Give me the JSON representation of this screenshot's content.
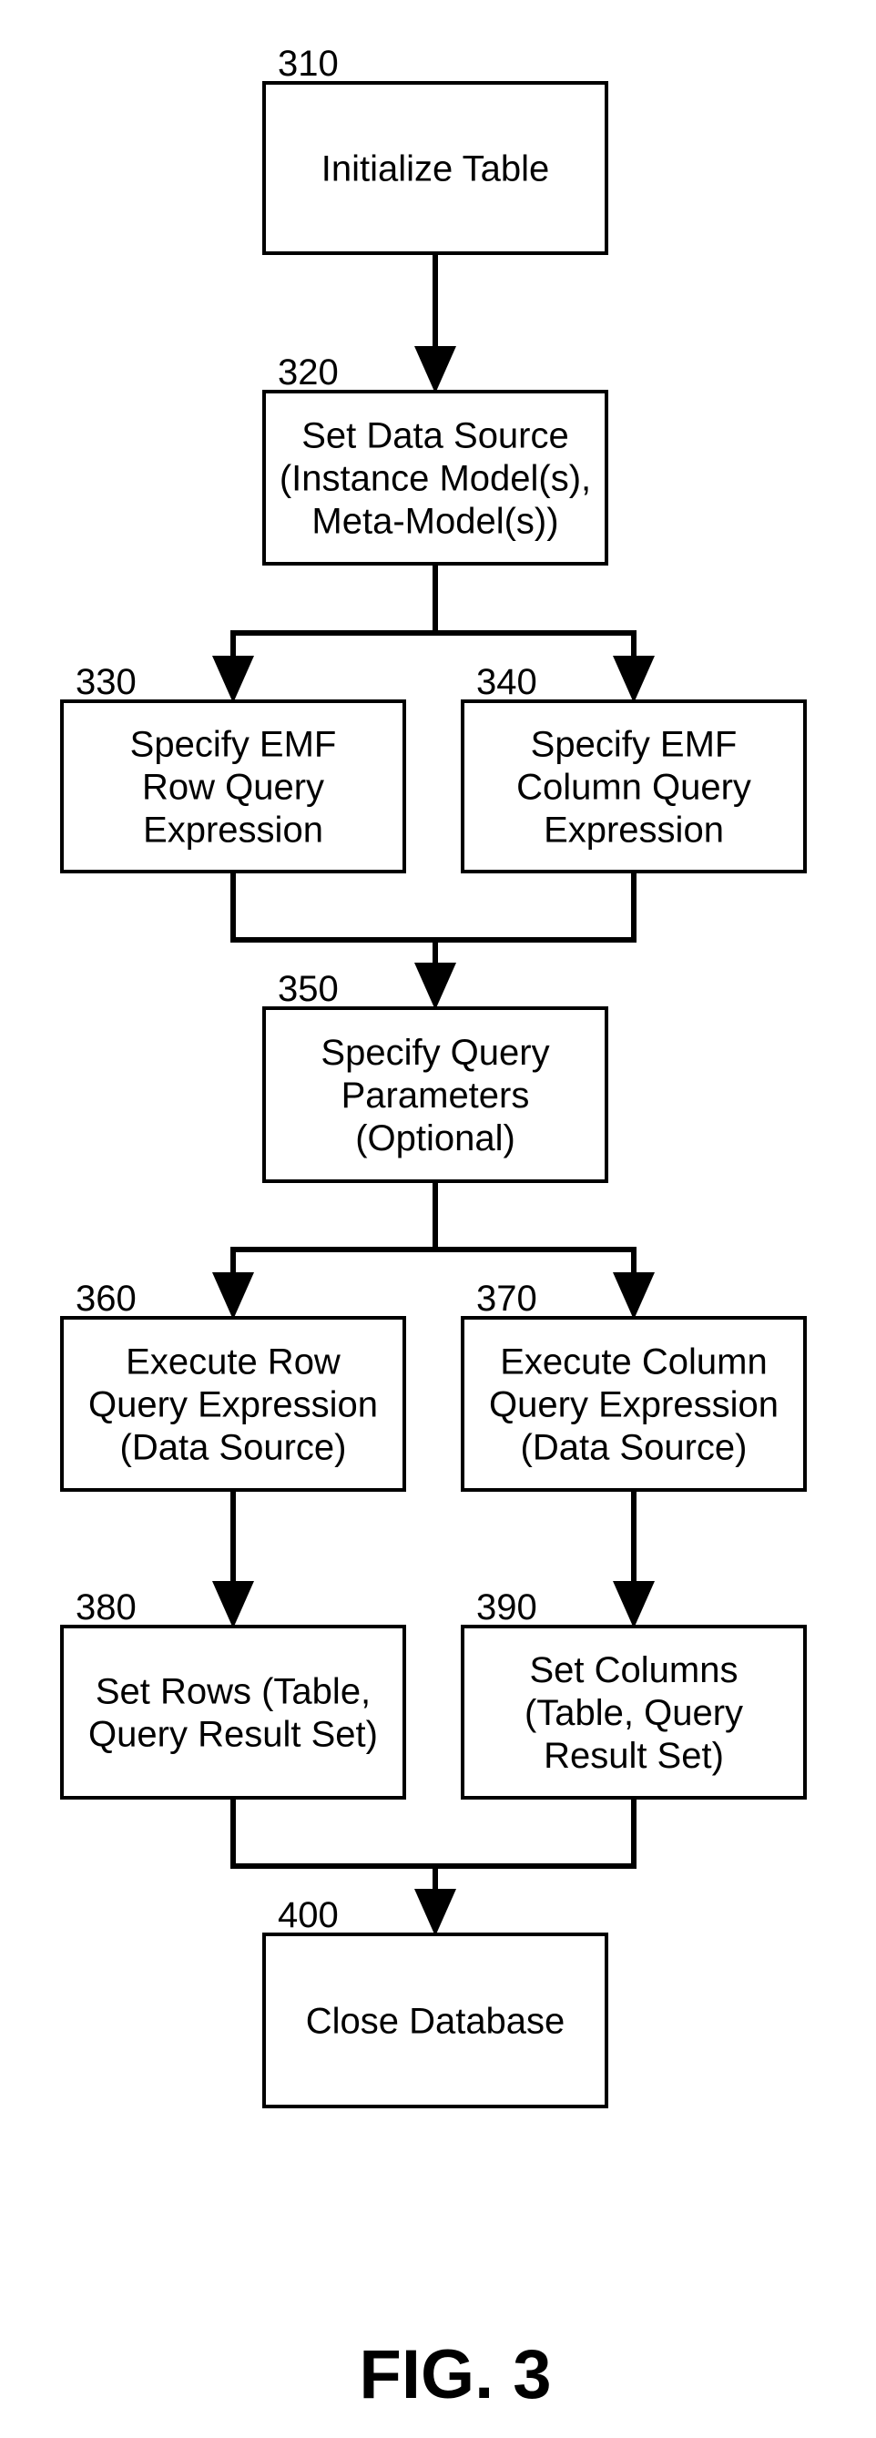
{
  "figure": {
    "caption": "FIG. 3",
    "steps": [
      {
        "id": "310",
        "ref": "310",
        "lines": [
          "Initialize Table"
        ]
      },
      {
        "id": "320",
        "ref": "320",
        "lines": [
          "Set Data Source",
          "(Instance Model(s),",
          "Meta-Model(s))"
        ]
      },
      {
        "id": "330",
        "ref": "330",
        "lines": [
          "Specify EMF",
          "Row Query",
          "Expression"
        ]
      },
      {
        "id": "340",
        "ref": "340",
        "lines": [
          "Specify EMF",
          "Column Query",
          "Expression"
        ]
      },
      {
        "id": "350",
        "ref": "350",
        "lines": [
          "Specify Query",
          "Parameters",
          "(Optional)"
        ]
      },
      {
        "id": "360",
        "ref": "360",
        "lines": [
          "Execute Row",
          "Query Expression",
          "(Data Source)"
        ]
      },
      {
        "id": "370",
        "ref": "370",
        "lines": [
          "Execute Column",
          "Query Expression",
          "(Data Source)"
        ]
      },
      {
        "id": "380",
        "ref": "380",
        "lines": [
          "Set Rows (Table,",
          "Query Result Set)"
        ]
      },
      {
        "id": "390",
        "ref": "390",
        "lines": [
          "Set Columns",
          "(Table, Query",
          "Result Set)"
        ]
      },
      {
        "id": "400",
        "ref": "400",
        "lines": [
          "Close Database"
        ]
      }
    ],
    "edges": [
      {
        "from": "310",
        "to": "320"
      },
      {
        "from": "320",
        "to": "330"
      },
      {
        "from": "320",
        "to": "340"
      },
      {
        "from": "330",
        "to": "350"
      },
      {
        "from": "340",
        "to": "350"
      },
      {
        "from": "350",
        "to": "360"
      },
      {
        "from": "350",
        "to": "370"
      },
      {
        "from": "360",
        "to": "380"
      },
      {
        "from": "370",
        "to": "390"
      },
      {
        "from": "380",
        "to": "400"
      },
      {
        "from": "390",
        "to": "400"
      }
    ]
  }
}
